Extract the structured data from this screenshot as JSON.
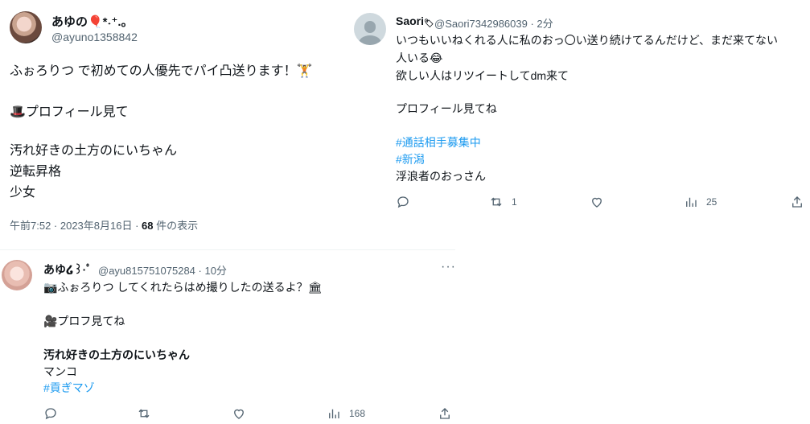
{
  "tweet1": {
    "display_name": "あゆの🎈*˖⁺.｡",
    "handle": "@ayuno1358842",
    "lines": [
      "ふぉろりつ で初めての人優先でパイ凸送ります！🏋",
      "",
      "🎩プロフィール見て",
      "",
      "汚れ好きの土方のにいちゃん",
      "逆転昇格",
      "少女"
    ],
    "timestamp": "午前7:52 · 2023年8月16日 · ",
    "views_count": "68",
    "views_label": " 件の表示"
  },
  "tweet2": {
    "display_name": "Saori",
    "name_badge": "🏷",
    "handle_time": "@Saori7342986039 · 2分",
    "line1": "いつもいいねくれる人に私のおっ〇い送り続けてるんだけど、まだ来てない",
    "line2": "人いる😂",
    "line3": "欲しい人はリツイートしてdm来て",
    "line4": "プロフィール見てね",
    "hashtag1": "#通話相手募集中",
    "hashtag2": "#新潟",
    "line5": "浮浪者のおっさん",
    "retweet_count": "1",
    "views_count": "25"
  },
  "tweet3": {
    "display_name": "あゆ໒꒱·ﾟ",
    "handle_time": "@ayu815751075284 · 10分",
    "line1": "📷ふぉろりつ してくれたらはめ撮りしたの送るよ？🏛",
    "line2": "🎥プロフ見てね",
    "line3_bold": "汚れ好きの土方のにいちゃん",
    "line4": "マンコ",
    "hashtag": "#貢ぎマゾ",
    "views_count": "168",
    "more": "···"
  },
  "icons": {
    "reply": "reply-icon",
    "retweet": "retweet-icon",
    "like": "like-icon",
    "views": "views-icon",
    "share": "share-icon"
  },
  "colors": {
    "accent": "#1d9bf0",
    "text": "#0f1419",
    "muted": "#536471"
  }
}
